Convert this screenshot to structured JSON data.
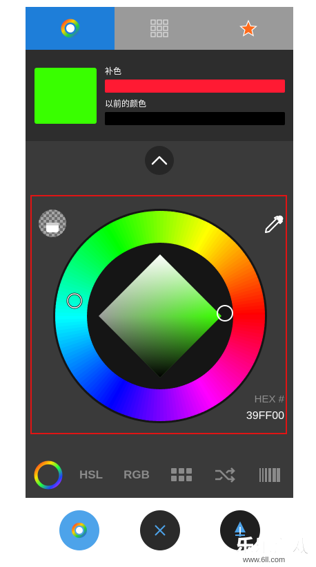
{
  "tabs": [
    {
      "name": "wheel",
      "icon": "color-wheel-icon",
      "active": true
    },
    {
      "name": "palette",
      "icon": "grid-icon",
      "active": false
    },
    {
      "name": "favorites",
      "icon": "star-icon",
      "active": false
    }
  ],
  "info": {
    "complement_label": "补色",
    "previous_label": "以前的颜色",
    "current_color": "#39FF00",
    "complement_color": "#FF1A33",
    "previous_color": "#000000"
  },
  "picker": {
    "hex_label": "HEX #",
    "hex_value": "39FF00"
  },
  "modes": {
    "hsl": "HSL",
    "rgb": "RGB"
  },
  "icons": {
    "alpha": "alpha-checker-icon",
    "eyedropper": "eyedropper-icon",
    "collapse": "chevron-up-icon",
    "grid": "swatches-grid-icon",
    "shuffle": "shuffle-icon",
    "barcode": "gradient-bars-icon",
    "close": "close-icon",
    "fill": "fill-bucket-icon"
  },
  "watermark": {
    "brand": "乐乐游戏",
    "url": "www.6ll.com"
  },
  "colors": {
    "accent": "#1E7ED9",
    "fab_blue": "#4DA3EA",
    "frame_red": "#E01414"
  }
}
